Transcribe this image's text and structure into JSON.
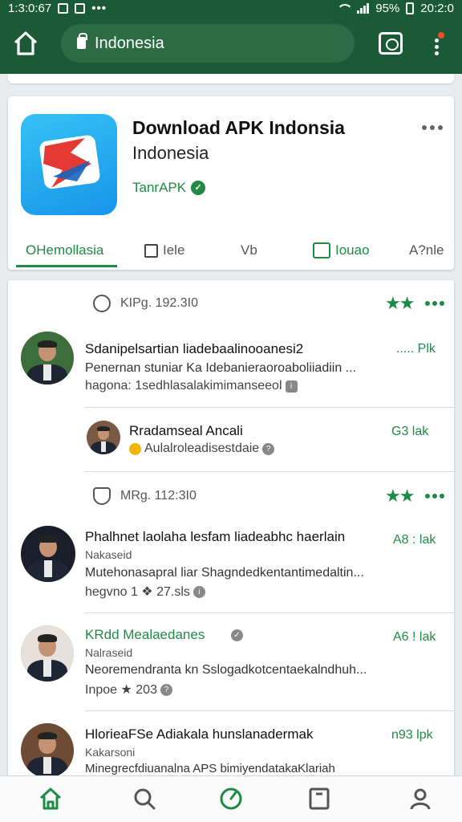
{
  "status_bar": {
    "time_left": "1:3:0:67",
    "signal_icons": "•••",
    "battery": "95%",
    "time_right": "20:2:0"
  },
  "browser": {
    "url": "Indonesia",
    "accent": "#1b5a36"
  },
  "app": {
    "title": "Download APK Indonsia",
    "subtitle": "Indonesia",
    "developer": "TanrAPK",
    "verified_mark": "✓",
    "icon": "apk-logo-icon"
  },
  "card_tabs": [
    {
      "label": "OHemollasia"
    },
    {
      "label": "Iele"
    },
    {
      "label": "Vb"
    },
    {
      "label": "Iouao"
    },
    {
      "label": "A?nle"
    }
  ],
  "sections": [
    {
      "label": "KIPg. 192.3I0",
      "items": [
        {
          "title": "Sdanipelsartian liadebaalinooanesi2",
          "count": "..... Plk",
          "text": "Penernan stuniar Ka Idebanieraoroaboliiadiin ...",
          "meta": "hagona: 1sedhlasalakimimanseeol",
          "meta_icon": "info-icon"
        },
        {
          "title": "Rradamseal Ancali",
          "count": "G3 lak",
          "meta": "Aulalroleadisestdaie",
          "meta_icon": "info-icon"
        }
      ]
    },
    {
      "label": "MRg. 112:3I0",
      "items": [
        {
          "title": "Phalhnet laolaha lesfam liadeabhc haerlain",
          "count": "A8 : lak",
          "author": "Nakaseid",
          "text": "Mutehonasapral liar Shagndedkentantimedaltin...",
          "meta": "hegvno 1 ❖ 27.sls"
        },
        {
          "title": "KRdd Mealaedanes",
          "count": "A6 ! lak",
          "author": "Nalraseid",
          "text": "Neoremendranta kn Sslogadkotcentaekalndhuh...",
          "meta": "Inpoe ★ 203"
        },
        {
          "title": "HlorieaFSe Adiakala hunslanadermak",
          "count": "n93 lpk",
          "author": "Kakarsoni",
          "text": "Minegrecfdiuanalna APS bimiyendatakaKlariah"
        }
      ]
    }
  ],
  "bottom_nav": [
    "home-icon",
    "search-icon",
    "updates-icon",
    "bookmark-icon",
    "profile-icon"
  ]
}
